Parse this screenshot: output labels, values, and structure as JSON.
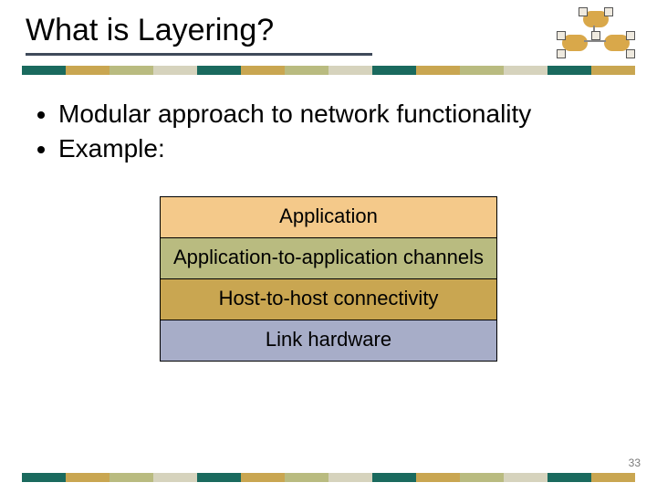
{
  "title": "What is Layering?",
  "bullets": [
    "Modular approach to network functionality",
    "Example:"
  ],
  "layers": [
    "Application",
    "Application-to-application channels",
    "Host-to-host connectivity",
    "Link hardware"
  ],
  "page_number": "33",
  "bar_colors": [
    "#1a6a5e",
    "#c9a651",
    "#b9bb80",
    "#d6d3bd",
    "#1a6a5e",
    "#c9a651",
    "#b9bb80",
    "#d6d3bd",
    "#1a6a5e",
    "#c9a651",
    "#b9bb80",
    "#d6d3bd",
    "#1a6a5e",
    "#c9a651"
  ]
}
